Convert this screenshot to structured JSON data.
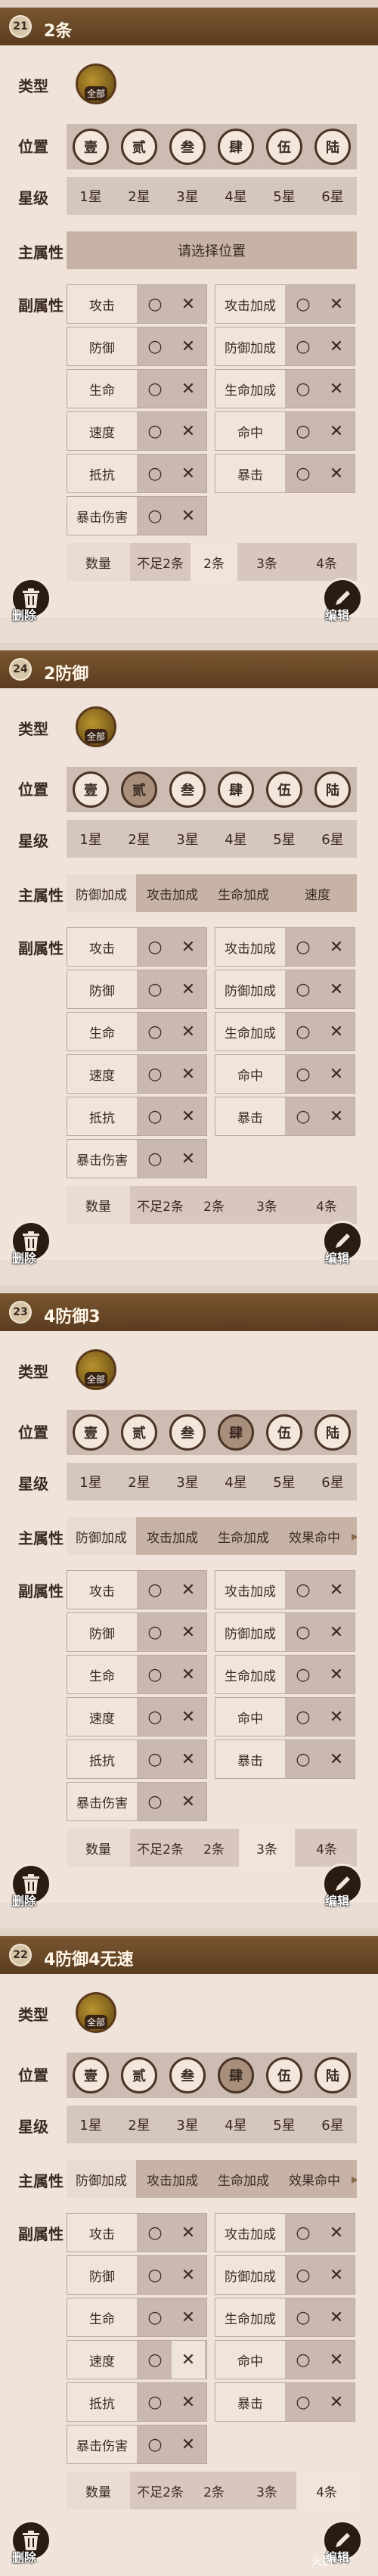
{
  "labels": {
    "type": "类型",
    "type_icon": "全部",
    "position": "位置",
    "star": "星级",
    "main": "主属性",
    "sub": "副属性",
    "quantity": "数量",
    "delete": "删除",
    "edit": "编辑"
  },
  "positions": [
    "壹",
    "贰",
    "叁",
    "肆",
    "伍",
    "陆"
  ],
  "stars": [
    "1星",
    "2星",
    "3星",
    "4星",
    "5星",
    "6星"
  ],
  "quantities": [
    "不足2条",
    "2条",
    "3条",
    "4条"
  ],
  "sub_names": [
    "攻击",
    "攻击加成",
    "防御",
    "防御加成",
    "生命",
    "生命加成",
    "速度",
    "命中",
    "抵抗",
    "暴击",
    "暴击伤害"
  ],
  "marks": {
    "o": "○",
    "x": "✕"
  },
  "main_options": [
    "防御加成",
    "攻击加成",
    "生命加成",
    "速度",
    "效果命中"
  ],
  "main_placeholder": "请选择位置",
  "cards": [
    {
      "num": "21",
      "title": "2条",
      "main_text": "请选择位置"
    },
    {
      "num": "24",
      "title": "2防御"
    },
    {
      "num": "23",
      "title": "4防御3"
    },
    {
      "num": "22",
      "title": "4防御4无速"
    }
  ],
  "watermark": "火鹏"
}
